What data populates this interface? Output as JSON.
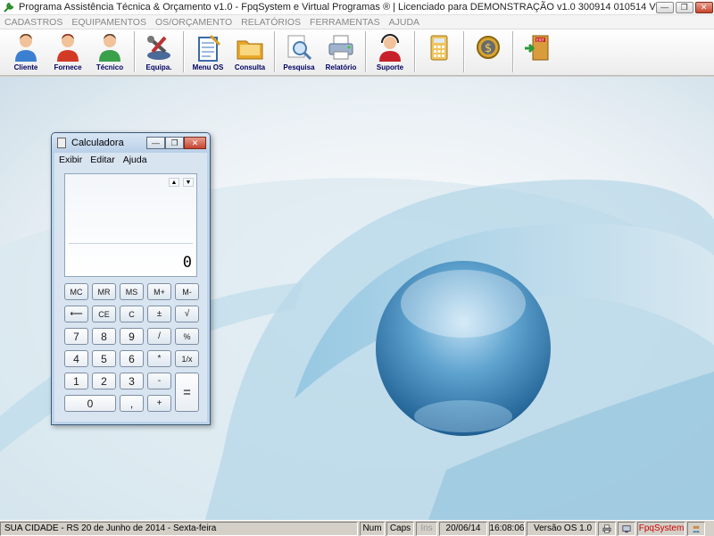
{
  "window": {
    "title": "Programa Assistência Técnica & Orçamento v1.0 - FpqSystem e Virtual Programas ® | Licenciado para  DEMONSTRAÇÃO v1.0 300914 010514 V",
    "buttons": {
      "minimize": "—",
      "maximize": "❐",
      "close": "✕"
    }
  },
  "menubar": {
    "items": [
      "CADASTROS",
      "EQUIPAMENTOS",
      "OS/ORÇAMENTO",
      "RELATÓRIOS",
      "FERRAMENTAS",
      "AJUDA"
    ]
  },
  "toolbar": {
    "items": [
      {
        "label": "Cliente",
        "icon": "cliente-person-icon"
      },
      {
        "label": "Fornece",
        "icon": "fornecedor-person-icon"
      },
      {
        "label": "Técnico",
        "icon": "tecnico-person-icon"
      },
      {
        "label": "Equipa.",
        "icon": "equipamento-tools-icon"
      },
      {
        "label": "Menu OS",
        "icon": "menu-os-notepad-icon"
      },
      {
        "label": "Consulta",
        "icon": "consulta-folder-icon"
      },
      {
        "label": "Pesquisa",
        "icon": "pesquisa-magnifier-icon"
      },
      {
        "label": "Relatório",
        "icon": "relatorio-printer-icon"
      },
      {
        "label": "Suporte",
        "icon": "suporte-headset-icon"
      },
      {
        "label": "",
        "icon": "calculator-icon"
      },
      {
        "label": "",
        "icon": "money-coin-icon"
      },
      {
        "label": "",
        "icon": "exit-door-icon"
      }
    ]
  },
  "calculator": {
    "title": "Calculadora",
    "menu": [
      "Exibir",
      "Editar",
      "Ajuda"
    ],
    "display_value": "0",
    "arrows": [
      "▲",
      "▼"
    ],
    "keys": [
      [
        "MC",
        "MR",
        "MS",
        "M+",
        "M-"
      ],
      [
        "⟵",
        "CE",
        "C",
        "±",
        "√"
      ],
      [
        "7",
        "8",
        "9",
        "/",
        "%"
      ],
      [
        "4",
        "5",
        "6",
        "*",
        "1/x"
      ],
      [
        "1",
        "2",
        "3",
        "-",
        "="
      ],
      [
        "0",
        ",",
        "+"
      ]
    ]
  },
  "statusbar": {
    "location": "SUA CIDADE - RS 20 de Junho de 2014 - Sexta-feira",
    "num": "Num",
    "caps": "Caps",
    "ins": "Ins",
    "date": "20/06/14",
    "time": "16:08:06",
    "version": "Versão OS 1.0",
    "brand": "FpqSystem"
  },
  "colors": {
    "toolbar_label": "#000060",
    "brand_text": "#cc0000",
    "desktop_blue": "#5b9fc6"
  }
}
